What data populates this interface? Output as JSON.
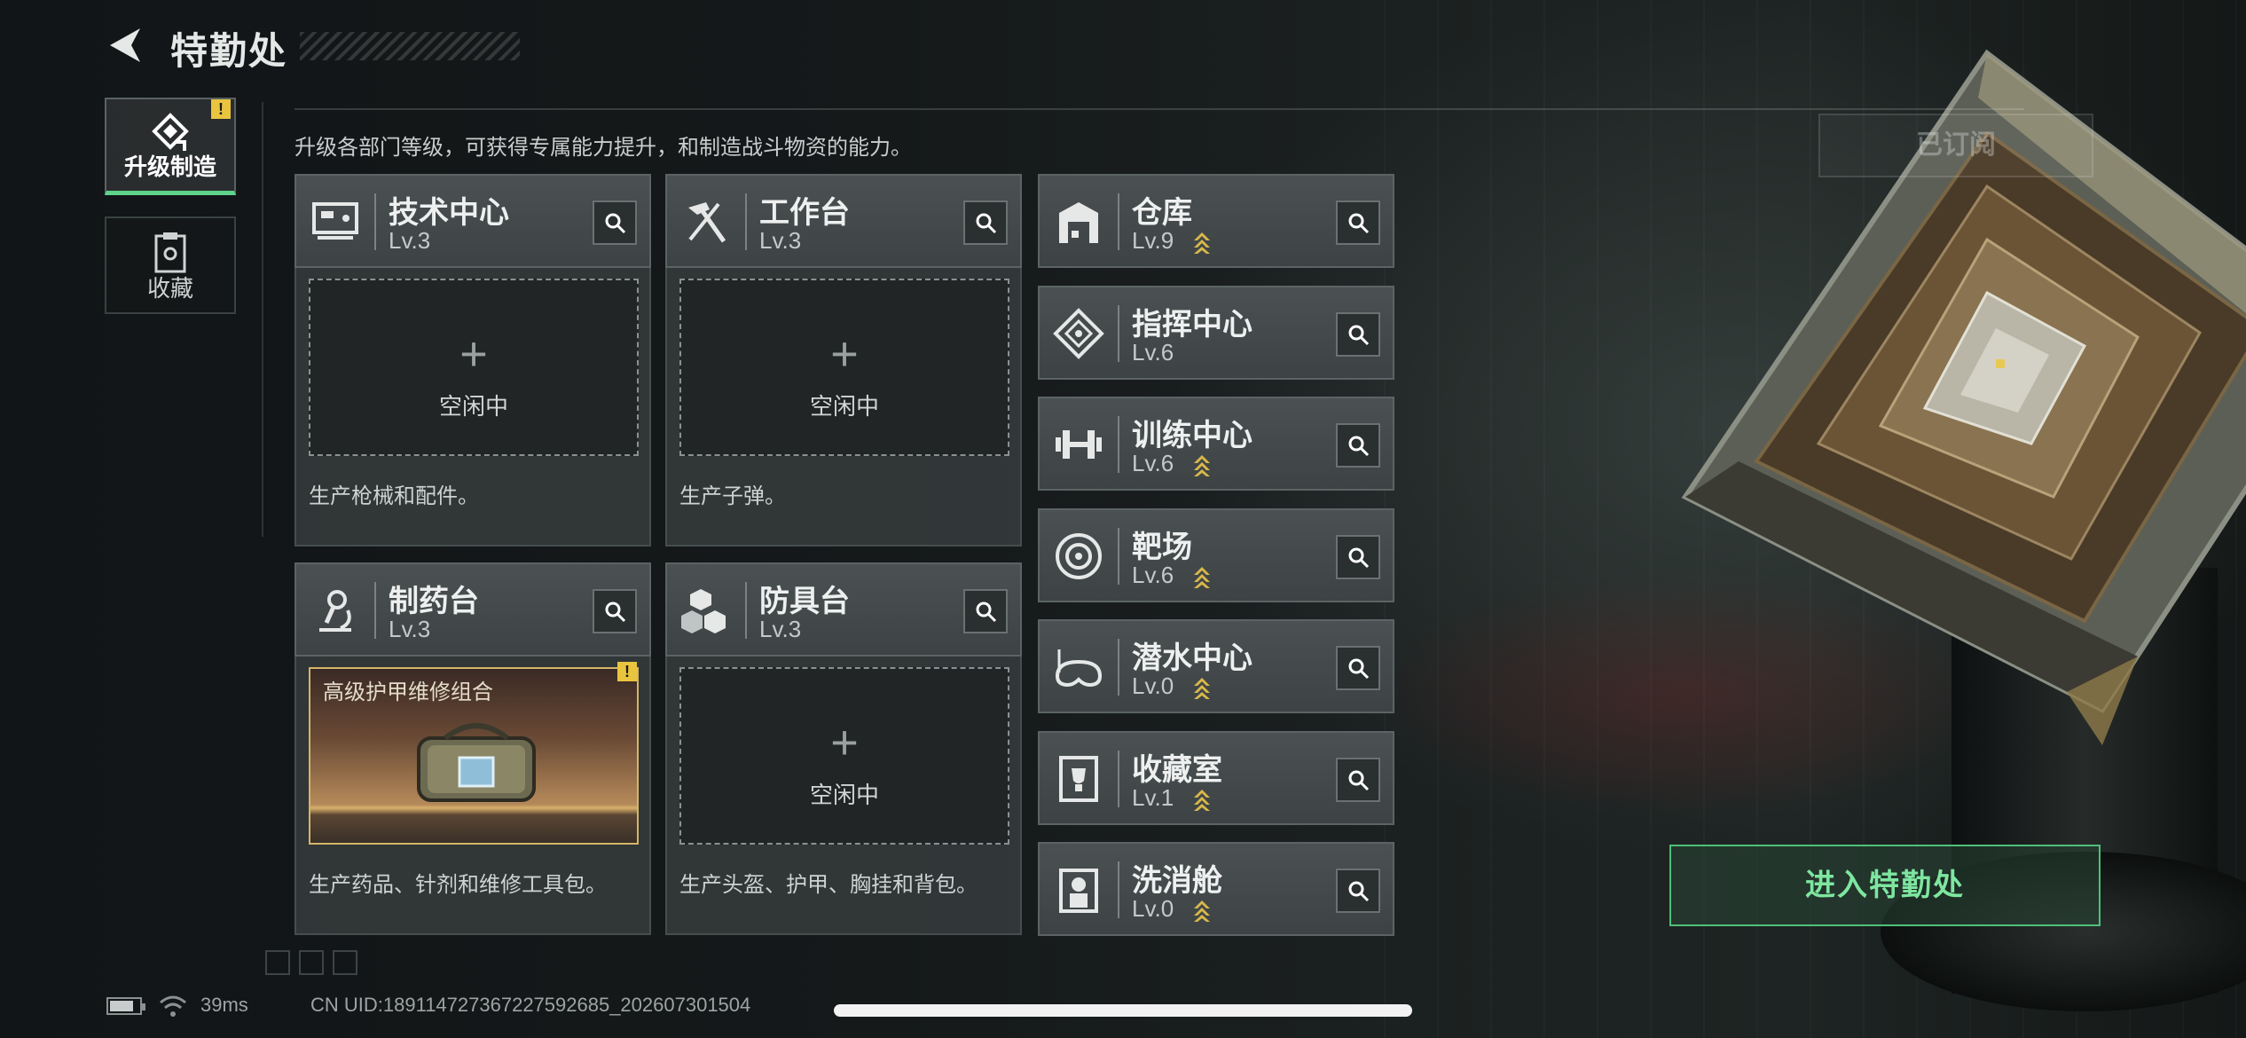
{
  "header": {
    "title": "特勤处",
    "back_icon": "back-arrow-icon"
  },
  "side_tabs": [
    {
      "label": "升级制造",
      "icon": "upgrade-icon",
      "active": true,
      "alert": "!"
    },
    {
      "label": "收藏",
      "icon": "collection-icon",
      "active": false
    }
  ],
  "description": "升级各部门等级，可获得专属能力提升，和制造战斗物资的能力。",
  "subscribed_label": "已订阅",
  "production_modules": [
    {
      "name": "技术中心",
      "level": "Lv.3",
      "icon": "monitor-icon",
      "slot": {
        "plus": "+",
        "text": "空闲中"
      },
      "desc": "生产枪械和配件。"
    },
    {
      "name": "工作台",
      "level": "Lv.3",
      "icon": "hammer-icon",
      "slot": {
        "plus": "+",
        "text": "空闲中"
      },
      "desc": "生产子弹。"
    },
    {
      "name": "制药台",
      "level": "Lv.3",
      "icon": "microscope-icon",
      "slot": {
        "item": "高级护甲维修组合",
        "alert": "!"
      },
      "desc": "生产药品、针剂和维修工具包。"
    },
    {
      "name": "防具台",
      "level": "Lv.3",
      "icon": "cubes-icon",
      "slot": {
        "plus": "+",
        "text": "空闲中"
      },
      "desc": "生产头盔、护甲、胸挂和背包。"
    }
  ],
  "facilities": [
    {
      "name": "仓库",
      "level": "Lv.9",
      "icon": "warehouse-icon",
      "upgradable": true
    },
    {
      "name": "指挥中心",
      "level": "Lv.6",
      "icon": "command-icon",
      "upgradable": false
    },
    {
      "name": "训练中心",
      "level": "Lv.6",
      "icon": "dumbbell-icon",
      "upgradable": true
    },
    {
      "name": "靶场",
      "level": "Lv.6",
      "icon": "target-icon",
      "upgradable": true
    },
    {
      "name": "潜水中心",
      "level": "Lv.0",
      "icon": "diving-mask-icon",
      "upgradable": true
    },
    {
      "name": "收藏室",
      "level": "Lv.1",
      "icon": "trophy-case-icon",
      "upgradable": true
    },
    {
      "name": "洗消舱",
      "level": "Lv.0",
      "icon": "hazmat-icon",
      "upgradable": true
    }
  ],
  "enter_button": "进入特勤处",
  "footer": {
    "ping": "39ms",
    "uid": "CN UID:18911472736722759​2685_202607301504"
  },
  "colors": {
    "accent_green": "#5ed38a",
    "alert_yellow": "#e9c43f",
    "upgrade_gold": "#d9b84a"
  }
}
